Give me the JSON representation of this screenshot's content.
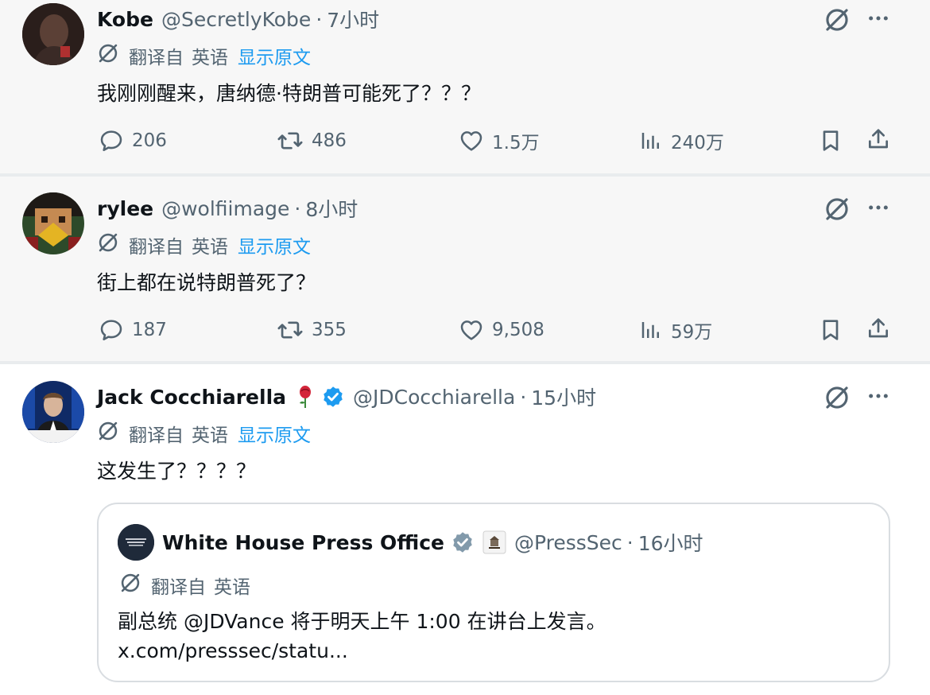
{
  "colors": {
    "link": "#1d9bf0",
    "muted": "#536471",
    "verified": "#1d9bf0",
    "text": "#0f1419"
  },
  "icons": {
    "translate": "translate-icon",
    "grok": "grok-icon",
    "more": "more-icon",
    "reply": "reply-icon",
    "retweet": "retweet-icon",
    "like": "like-icon",
    "views": "views-icon",
    "bookmark": "bookmark-icon",
    "share": "share-icon",
    "verified": "verified-badge-icon",
    "rose": "rose-emoji-icon"
  },
  "tweets": [
    {
      "name": "Kobe",
      "handle": "@SecretlyKobe",
      "separator": "·",
      "time": "7小时",
      "translated_from": "翻译自",
      "language": "英语",
      "show_original": "显示原文",
      "text": "我刚刚醒来，唐纳德·特朗普可能死了？？？",
      "replies": "206",
      "retweets": "486",
      "likes": "1.5万",
      "views": "240万"
    },
    {
      "name": "rylee",
      "handle": "@wolfiimage",
      "separator": "·",
      "time": "8小时",
      "translated_from": "翻译自",
      "language": "英语",
      "show_original": "显示原文",
      "text": "街上都在说特朗普死了？",
      "replies": "187",
      "retweets": "355",
      "likes": "9,508",
      "views": "59万"
    },
    {
      "name": "Jack Cocchiarella",
      "handle": "@JDCocchiarella",
      "separator": "·",
      "time": "15小时",
      "translated_from": "翻译自",
      "language": "英语",
      "show_original": "显示原文",
      "text": "这发生了？？？？",
      "quote": {
        "name": "White House Press Office",
        "handle": "@PressSec",
        "separator": "·",
        "time": "16小时",
        "translated_from": "翻译自",
        "language": "英语",
        "text": "副总统 @JDVance 将于明天上午 1:00 在讲台上发言。",
        "link": "x.com/presssec/statu..."
      }
    }
  ]
}
